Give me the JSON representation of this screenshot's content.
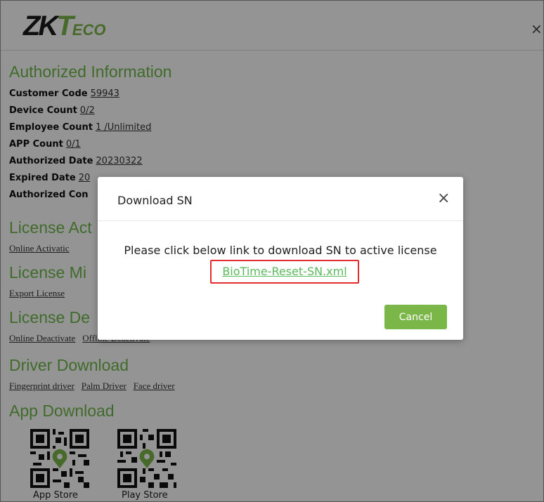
{
  "header": {
    "logo_zk": "ZK",
    "logo_t": "T",
    "logo_eco": "ECO",
    "close_glyph": "×"
  },
  "authorized": {
    "title": "Authorized Information",
    "rows": [
      {
        "label": "Customer Code",
        "value": "59943"
      },
      {
        "label": "Device Count",
        "value": "0/2"
      },
      {
        "label": "Employee Count",
        "value": "1 /Unlimited"
      },
      {
        "label": "APP Count",
        "value": "0/1"
      },
      {
        "label": "Authorized Date",
        "value": "20230322"
      },
      {
        "label": "Expired Date",
        "value": "20"
      },
      {
        "label": "Authorized Con",
        "value": ""
      }
    ]
  },
  "license_activation": {
    "title": "License Act",
    "links": [
      "Online Activatic"
    ]
  },
  "license_migration": {
    "title": "License Mi",
    "links": [
      "Export License"
    ]
  },
  "license_deactivation": {
    "title": "License De",
    "links": [
      "Online Deactivate",
      "Offline Deactivate"
    ]
  },
  "driver_download": {
    "title": "Driver Download",
    "links": [
      "Fingerprint driver",
      "Palm Driver",
      "Face driver"
    ]
  },
  "app_download": {
    "title": "App Download",
    "apps": [
      {
        "label": "App Store"
      },
      {
        "label": "Play Store"
      }
    ]
  },
  "modal": {
    "title": "Download SN",
    "close_glyph": "×",
    "message": "Please click below link to download SN to active license",
    "link_text": "BioTime-Reset-SN.xml",
    "cancel_label": "Cancel"
  },
  "colors": {
    "brand_green": "#7ab648",
    "section_green": "#6fb94b",
    "link_green": "#5cb85c",
    "highlight_red": "#e52b2b"
  },
  "icons": {
    "close": "close-icon",
    "qr": "qr-code-icon",
    "location": "location-pin-icon"
  }
}
